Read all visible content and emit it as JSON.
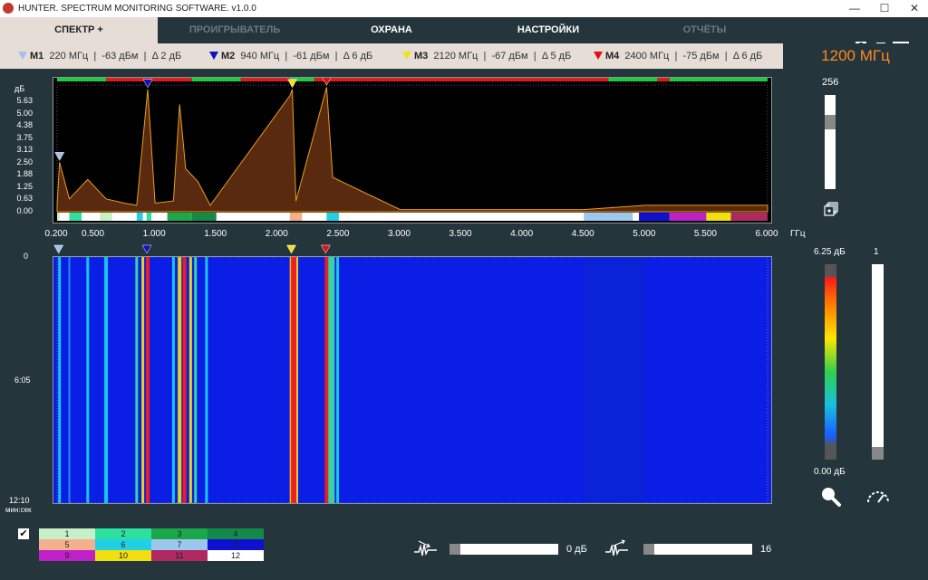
{
  "app": {
    "title": "HUNTER. SPECTRUM MONITORING SOFTWARE. v1.0.0"
  },
  "window_controls": {
    "minimize": "—",
    "maximize": "☐",
    "close": "✕"
  },
  "tabs": [
    {
      "label": "СПЕКТР +",
      "state": "active"
    },
    {
      "label": "ПРОИГРЫВАТЕЛЬ",
      "state": "dim"
    },
    {
      "label": "ОХРАНА",
      "state": "on"
    },
    {
      "label": "НАСТРОЙКИ",
      "state": "on"
    },
    {
      "label": "ОТЧЁТЫ",
      "state": "dim"
    }
  ],
  "header_icons": {
    "help": "?",
    "help_icon": "help-icon",
    "report_icon": "report-icon",
    "flag_icon": "russian-flag-icon"
  },
  "markers": [
    {
      "name": "M1",
      "freq": "220 МГц",
      "level": "-63 дБм",
      "delta": "Δ 2 дБ",
      "color": "#9ec3ee"
    },
    {
      "name": "M2",
      "freq": "940 МГц",
      "level": "-61 дБм",
      "delta": "Δ 6 дБ",
      "color": "#1010c0"
    },
    {
      "name": "M3",
      "freq": "2120 МГц",
      "level": "-67 дБм",
      "delta": "Δ 5 дБ",
      "color": "#f3e21a"
    },
    {
      "name": "M4",
      "freq": "2400 МГц",
      "level": "-75 дБм",
      "delta": "Δ 6 дБ",
      "color": "#e01010"
    }
  ],
  "center_freq": "1200 МГц",
  "spectrum": {
    "y_unit": "дБ",
    "y_ticks": [
      "5.63",
      "5.00",
      "4.38",
      "3.75",
      "3.13",
      "2.50",
      "1.88",
      "1.25",
      "0.63",
      "0.00"
    ],
    "x_unit": "ГГц",
    "x_ticks": [
      "0.200",
      "0.500",
      "1.000",
      "1.500",
      "2.000",
      "2.500",
      "3.000",
      "3.500",
      "4.000",
      "4.500",
      "5.000",
      "5.500",
      "6.000"
    ],
    "max_value": "256",
    "stack_icon": "layers-icon"
  },
  "waterfall": {
    "y_ticks": [
      "0",
      "6:05",
      "12:10"
    ],
    "y_unit": "мин:сек",
    "scale_top": "6.25 дБ",
    "scale_bottom": "0.00 дБ",
    "right_slider_top": "1",
    "zoom_icon": "magnifier-icon",
    "speed_icon": "speedometer-icon"
  },
  "chart_data": {
    "type": "line",
    "x_unit": "ГГц",
    "y_unit": "дБ",
    "xlim": [
      0.2,
      6.0
    ],
    "ylim": [
      0,
      5.63
    ],
    "x": [
      0.2,
      0.22,
      0.3,
      0.45,
      0.6,
      0.75,
      0.85,
      0.94,
      1.0,
      1.15,
      1.2,
      1.25,
      1.35,
      1.45,
      2.1,
      2.12,
      2.15,
      2.4,
      2.45,
      3.0,
      4.5,
      5.0,
      5.5,
      6.0
    ],
    "y": [
      0.3,
      2.3,
      0.6,
      1.5,
      0.6,
      0.4,
      0.3,
      5.7,
      0.4,
      0.5,
      5.0,
      2.0,
      1.4,
      0.3,
      5.4,
      5.7,
      0.5,
      5.8,
      1.6,
      0.1,
      0.1,
      0.3,
      0.3,
      0.3
    ]
  },
  "bottom": {
    "checkbox_checked": true,
    "palette": [
      {
        "n": "1",
        "color": "#c8f0c8"
      },
      {
        "n": "2",
        "color": "#2ee0a0"
      },
      {
        "n": "3",
        "color": "#1aa84a"
      },
      {
        "n": "4",
        "color": "#138a4a"
      },
      {
        "n": "5",
        "color": "#f4b08c"
      },
      {
        "n": "6",
        "color": "#22d0e6"
      },
      {
        "n": "7",
        "color": "#9cc8f0"
      },
      {
        "n": "8",
        "color": "#1010d0"
      },
      {
        "n": "9",
        "color": "#c020c8"
      },
      {
        "n": "10",
        "color": "#f0e010"
      },
      {
        "n": "11",
        "color": "#b02860"
      },
      {
        "n": "12",
        "color": "#ffffff"
      }
    ],
    "gain_value": "0 дБ",
    "avg_value": "16",
    "gain_icon": "signal-down-icon",
    "avg_icon": "signal-up-icon"
  }
}
